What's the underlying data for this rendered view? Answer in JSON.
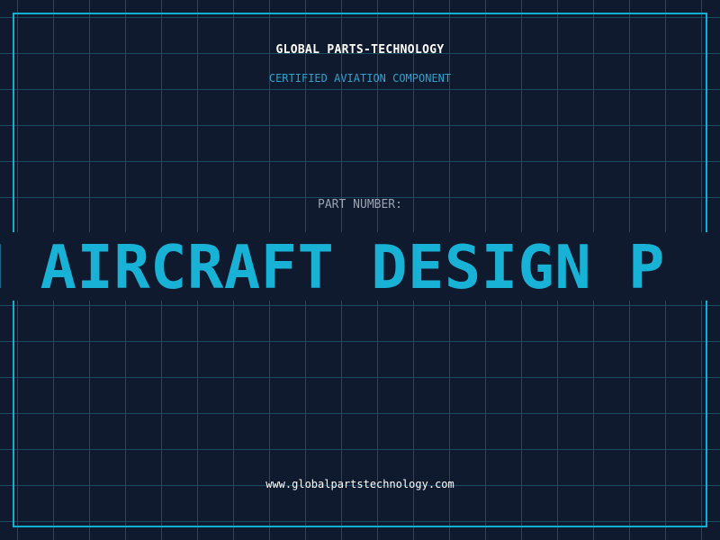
{
  "header": {
    "brand": "GLOBAL PARTS-TECHNOLOGY",
    "tagline": "CERTIFIED AVIATION COMPONENT"
  },
  "part": {
    "label": "PART NUMBER:",
    "ticker_text": "M AIRCRAFT DESIGN P"
  },
  "footer": {
    "website": "www.globalpartstechnology.com"
  },
  "colors": {
    "background": "#101a2e",
    "grid": "#1d4a63",
    "frame": "#0fb0d2",
    "accent": "#17b2d6",
    "muted": "#9aa3b2"
  }
}
